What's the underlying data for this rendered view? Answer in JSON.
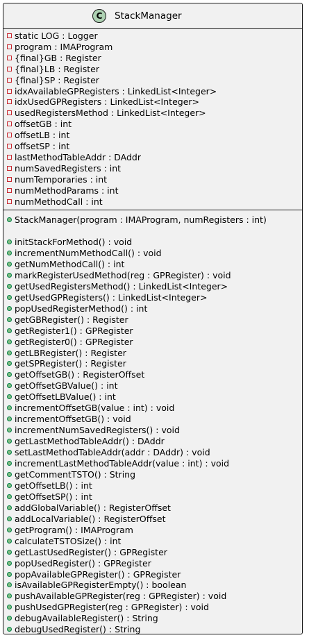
{
  "class": {
    "name": "StackManager",
    "stereotype_letter": "C"
  },
  "visibility_colors": {
    "private_border": "#c82930",
    "public_fill": "#84be84",
    "public_border": "#038048",
    "class_icon_fill": "#add1b2",
    "box_fill": "#f1f1f1"
  },
  "fields": [
    {
      "visibility": "private",
      "text": "static LOG : Logger"
    },
    {
      "visibility": "private",
      "text": "program : IMAProgram"
    },
    {
      "visibility": "private",
      "text": "{final}GB : Register"
    },
    {
      "visibility": "private",
      "text": "{final}LB : Register"
    },
    {
      "visibility": "private",
      "text": "{final}SP : Register"
    },
    {
      "visibility": "private",
      "text": "idxAvailableGPRegisters : LinkedList<Integer>"
    },
    {
      "visibility": "private",
      "text": "idxUsedGPRegisters : LinkedList<Integer>"
    },
    {
      "visibility": "private",
      "text": "usedRegistersMethod : LinkedList<Integer>"
    },
    {
      "visibility": "private",
      "text": "offsetGB : int"
    },
    {
      "visibility": "private",
      "text": "offsetLB : int"
    },
    {
      "visibility": "private",
      "text": "offsetSP : int"
    },
    {
      "visibility": "private",
      "text": "lastMethodTableAddr : DAddr"
    },
    {
      "visibility": "private",
      "text": "numSavedRegisters : int"
    },
    {
      "visibility": "private",
      "text": "numTemporaries : int"
    },
    {
      "visibility": "private",
      "text": "numMethodParams : int"
    },
    {
      "visibility": "private",
      "text": "numMethodCall : int"
    }
  ],
  "constructor": {
    "visibility": "public",
    "text": "StackManager(program : IMAProgram, numRegisters : int)"
  },
  "methods": [
    {
      "visibility": "public",
      "text": "initStackForMethod() : void"
    },
    {
      "visibility": "public",
      "text": "incrementNumMethodCall() : void"
    },
    {
      "visibility": "public",
      "text": "getNumMethodCall() : int"
    },
    {
      "visibility": "public",
      "text": "markRegisterUsedMethod(reg : GPRegister) : void"
    },
    {
      "visibility": "public",
      "text": "getUsedRegistersMethod() : LinkedList<Integer>"
    },
    {
      "visibility": "public",
      "text": "getUsedGPRegisters() : LinkedList<Integer>"
    },
    {
      "visibility": "public",
      "text": "popUsedRegisterMethod() : int"
    },
    {
      "visibility": "public",
      "text": "getGBRegister() : Register"
    },
    {
      "visibility": "public",
      "text": "getRegister1() : GPRegister"
    },
    {
      "visibility": "public",
      "text": "getRegister0() : GPRegister"
    },
    {
      "visibility": "public",
      "text": "getLBRegister() : Register"
    },
    {
      "visibility": "public",
      "text": "getSPRegister() : Register"
    },
    {
      "visibility": "public",
      "text": "getOffsetGB() : RegisterOffset"
    },
    {
      "visibility": "public",
      "text": "getOffsetGBValue() : int"
    },
    {
      "visibility": "public",
      "text": "getOffsetLBValue() : int"
    },
    {
      "visibility": "public",
      "text": "incrementOffsetGB(value : int) : void"
    },
    {
      "visibility": "public",
      "text": "incrementOffsetGB() : void"
    },
    {
      "visibility": "public",
      "text": "incrementNumSavedRegisters() : void"
    },
    {
      "visibility": "public",
      "text": "getLastMethodTableAddr() : DAddr"
    },
    {
      "visibility": "public",
      "text": "setLastMethodTableAddr(addr : DAddr) : void"
    },
    {
      "visibility": "public",
      "text": "incrementLastMethodTableAddr(value : int) : void"
    },
    {
      "visibility": "public",
      "text": "getCommentTSTO() : String"
    },
    {
      "visibility": "public",
      "text": "getOffsetLB() : int"
    },
    {
      "visibility": "public",
      "text": "getOffsetSP() : int"
    },
    {
      "visibility": "public",
      "text": "addGlobalVariable() : RegisterOffset"
    },
    {
      "visibility": "public",
      "text": "addLocalVariable() : RegisterOffset"
    },
    {
      "visibility": "public",
      "text": "getProgram() : IMAProgram"
    },
    {
      "visibility": "public",
      "text": "calculateTSTOSize() : int"
    },
    {
      "visibility": "public",
      "text": "getLastUsedRegister() : GPRegister"
    },
    {
      "visibility": "public",
      "text": "popUsedRegister() : GPRegister"
    },
    {
      "visibility": "public",
      "text": "popAvailableGPRegister() : GPRegister"
    },
    {
      "visibility": "public",
      "text": "isAvailableGPRegisterEmpty() : boolean"
    },
    {
      "visibility": "public",
      "text": "pushAvailableGPRegister(reg : GPRegister) : void"
    },
    {
      "visibility": "public",
      "text": "pushUsedGPRegister(reg : GPRegister) : void"
    },
    {
      "visibility": "public",
      "text": "debugAvailableRegister() : String"
    },
    {
      "visibility": "public",
      "text": "debugUsedRegister() : String"
    }
  ]
}
